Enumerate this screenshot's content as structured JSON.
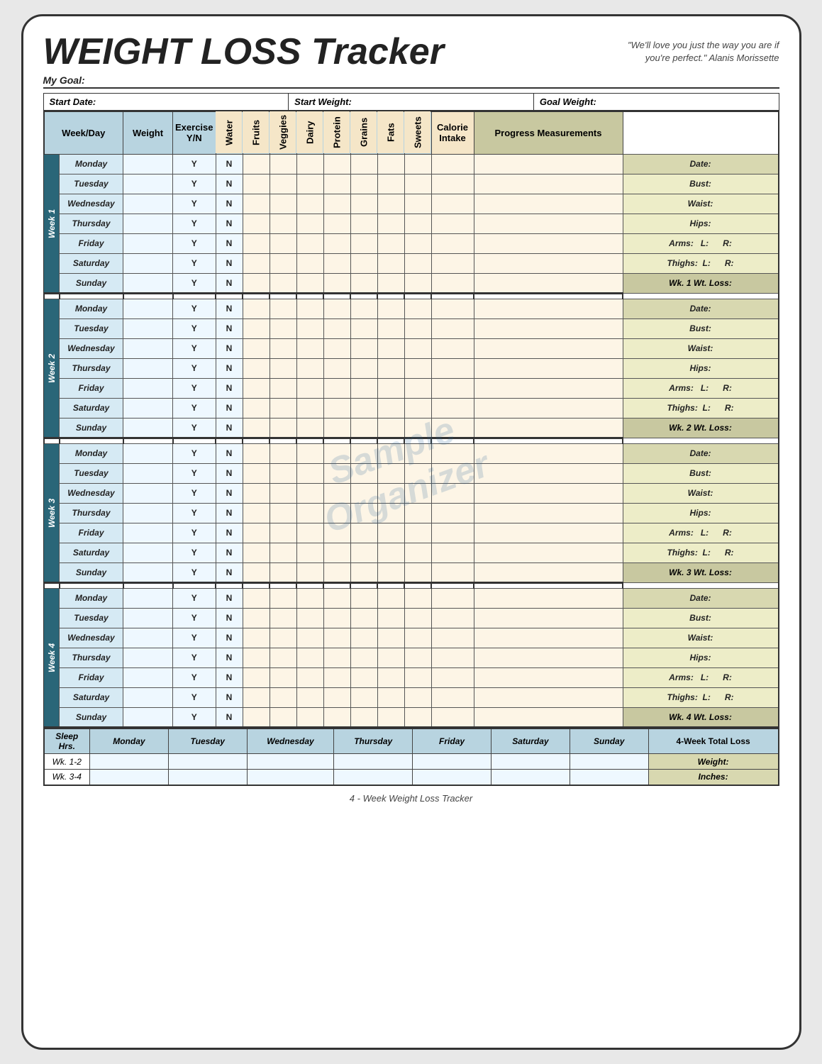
{
  "title": "WEIGHT LOSS Tracker",
  "quote": "\"We'll love you just the way you are if you're perfect.\"  Alanis Morissette",
  "my_goal_label": "My Goal:",
  "start_date_label": "Start Date:",
  "start_weight_label": "Start Weight:",
  "goal_weight_label": "Goal Weight:",
  "columns": {
    "week_day": "Week/Day",
    "weight": "Weight",
    "exercise": "Exercise Y/N",
    "water": "Water",
    "fruits": "Fruits",
    "veggies": "Veggies",
    "dairy": "Dairy",
    "protein": "Protein",
    "grains": "Grains",
    "fats": "Fats",
    "sweets": "Sweets",
    "calorie_intake": "Calorie Intake",
    "progress_measurements": "Progress Measurements"
  },
  "weeks": [
    {
      "label": "Week 1",
      "days": [
        "Monday",
        "Tuesday",
        "Wednesday",
        "Thursday",
        "Friday",
        "Saturday",
        "Sunday"
      ],
      "progress": {
        "date": "Date:",
        "bust": "Bust:",
        "waist": "Waist:",
        "hips": "Hips:",
        "arms": "Arms:",
        "arms_l": "L:",
        "arms_r": "R:",
        "thighs": "Thighs:",
        "thighs_l": "L:",
        "thighs_r": "R:",
        "wt_loss": "Wk. 1 Wt. Loss:"
      }
    },
    {
      "label": "Week 2",
      "days": [
        "Monday",
        "Tuesday",
        "Wednesday",
        "Thursday",
        "Friday",
        "Saturday",
        "Sunday"
      ],
      "progress": {
        "date": "Date:",
        "bust": "Bust:",
        "waist": "Waist:",
        "hips": "Hips:",
        "arms": "Arms:",
        "arms_l": "L:",
        "arms_r": "R:",
        "thighs": "Thighs:",
        "thighs_l": "L:",
        "thighs_r": "R:",
        "wt_loss": "Wk. 2 Wt. Loss:"
      }
    },
    {
      "label": "Week 3",
      "days": [
        "Monday",
        "Tuesday",
        "Wednesday",
        "Thursday",
        "Friday",
        "Saturday",
        "Sunday"
      ],
      "progress": {
        "date": "Date:",
        "bust": "Bust:",
        "waist": "Waist:",
        "hips": "Hips:",
        "arms": "Arms:",
        "arms_l": "L:",
        "arms_r": "R:",
        "thighs": "Thighs:",
        "thighs_l": "L:",
        "thighs_r": "R:",
        "wt_loss": "Wk. 3 Wt. Loss:"
      }
    },
    {
      "label": "Week 4",
      "days": [
        "Monday",
        "Tuesday",
        "Wednesday",
        "Thursday",
        "Friday",
        "Saturday",
        "Sunday"
      ],
      "progress": {
        "date": "Date:",
        "bust": "Bust:",
        "waist": "Waist:",
        "hips": "Hips:",
        "arms": "Arms:",
        "arms_l": "L:",
        "arms_r": "R:",
        "thighs": "Thighs:",
        "thighs_l": "L:",
        "thighs_r": "R:",
        "wt_loss": "Wk. 4 Wt. Loss:"
      }
    }
  ],
  "bottom": {
    "sleep_hrs": "Sleep Hrs.",
    "days": [
      "Monday",
      "Tuesday",
      "Wednesday",
      "Thursday",
      "Friday",
      "Saturday",
      "Sunday"
    ],
    "wk12": "Wk. 1-2",
    "wk34": "Wk. 3-4",
    "four_week_total": "4-Week Total Loss",
    "weight_label": "Weight:",
    "inches_label": "Inches:"
  },
  "footer": "4 - Week Weight Loss Tracker",
  "watermark_line1": "Sample",
  "watermark_line2": "Organizer"
}
